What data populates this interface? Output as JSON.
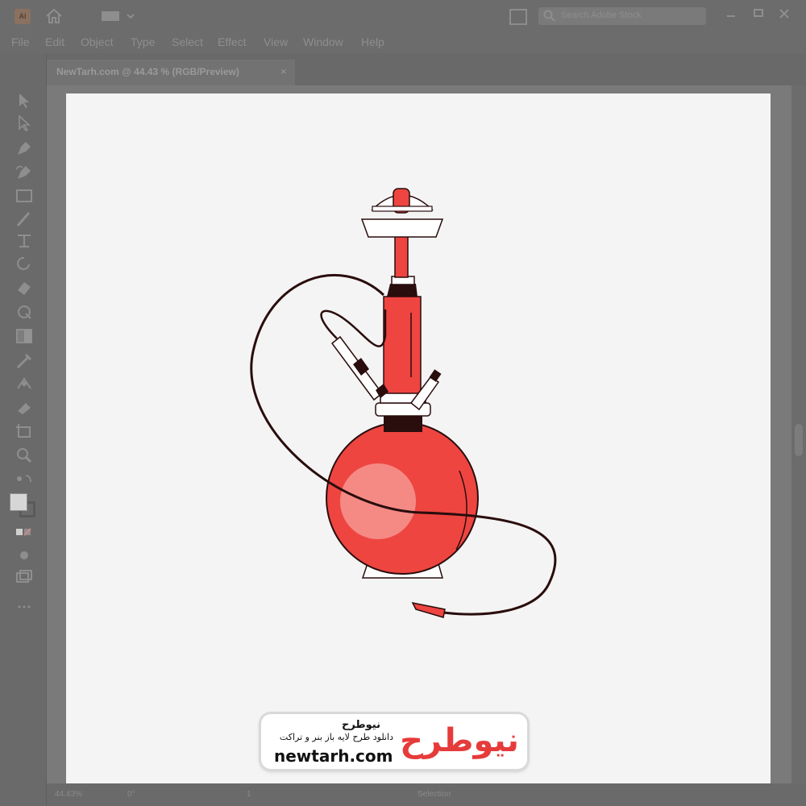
{
  "app": {
    "icon_label": "Ai",
    "search_placeholder": "Search Adobe Stock"
  },
  "menu": [
    "File",
    "Edit",
    "Object",
    "Type",
    "Select",
    "Effect",
    "View",
    "Window",
    "Help"
  ],
  "document": {
    "tab_title": "NewTarh.com @ 44.43 % (RGB/Preview)",
    "close_glyph": "×"
  },
  "status": {
    "zoom": "44.43%",
    "rotation": "0°",
    "artboard_nav": "1",
    "tool_name": "Selection"
  },
  "tools": [
    "selection-tool-icon",
    "direct-selection-tool-icon",
    "pen-tool-icon",
    "curvature-tool-icon",
    "rectangle-tool-icon",
    "paintbrush-tool-icon",
    "width-tool-icon",
    "rotate-tool-icon",
    "eraser-tool-icon",
    "shape-builder-tool-icon",
    "gradient-tool-icon",
    "eyedropper-tool-icon",
    "blend-tool-icon",
    "symbol-sprayer-tool-icon",
    "artboard-tool-icon",
    "zoom-tool-icon"
  ],
  "colors": {
    "hookah_red": "#ee4540",
    "hookah_dark": "#2a0d0d",
    "highlight": "#f58a85",
    "artboard": "#f4f4f4"
  },
  "watermark": {
    "brand_fa": "نیوطرح",
    "tagline_fa": "دانلود طرح لایه باز بنر و تراکت",
    "url": "newtarh.com",
    "logo_text": "نیوطرح"
  }
}
